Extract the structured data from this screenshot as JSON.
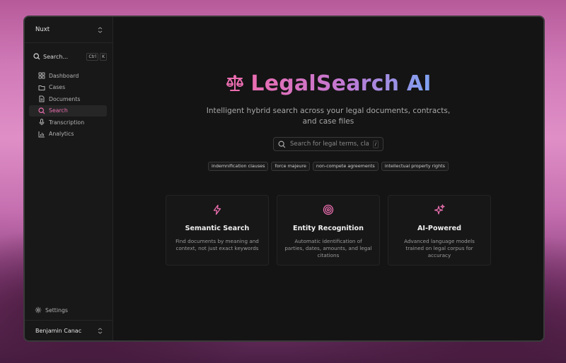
{
  "sidebar": {
    "workspace": "Nuxt",
    "search": {
      "label": "Search...",
      "shortcut": [
        "Ctrl",
        "K"
      ]
    },
    "items": [
      {
        "label": "Dashboard",
        "icon": "dashboard-icon",
        "active": false
      },
      {
        "label": "Cases",
        "icon": "folder-icon",
        "active": false
      },
      {
        "label": "Documents",
        "icon": "document-icon",
        "active": false
      },
      {
        "label": "Search",
        "icon": "search-icon",
        "active": true
      },
      {
        "label": "Transcription",
        "icon": "microphone-icon",
        "active": false
      },
      {
        "label": "Analytics",
        "icon": "bar-chart-icon",
        "active": false
      }
    ],
    "settings_label": "Settings",
    "user_name": "Benjamin Canac"
  },
  "hero": {
    "title": "LegalSearch AI",
    "icon": "scales-icon",
    "subtitle": "Intelligent hybrid search across your legal documents, contracts, and case files",
    "search_placeholder": "Search for legal terms, clauses...",
    "search_shortcut": "/",
    "suggestions": [
      "indemnification clauses",
      "force majeure",
      "non-compete agreements",
      "intellectual property rights"
    ]
  },
  "features": [
    {
      "title": "Semantic Search",
      "description": "Find documents by meaning and context, not just exact keywords",
      "icon": "lightning-icon"
    },
    {
      "title": "Entity Recognition",
      "description": "Automatic identification of parties, dates, amounts, and legal citations",
      "icon": "target-icon"
    },
    {
      "title": "AI-Powered",
      "description": "Advanced language models trained on legal corpus for accuracy",
      "icon": "sparkles-icon"
    }
  ],
  "colors": {
    "accent": "#ec6fb0",
    "gradient_end": "#7ea2f2",
    "background": "#141414"
  }
}
